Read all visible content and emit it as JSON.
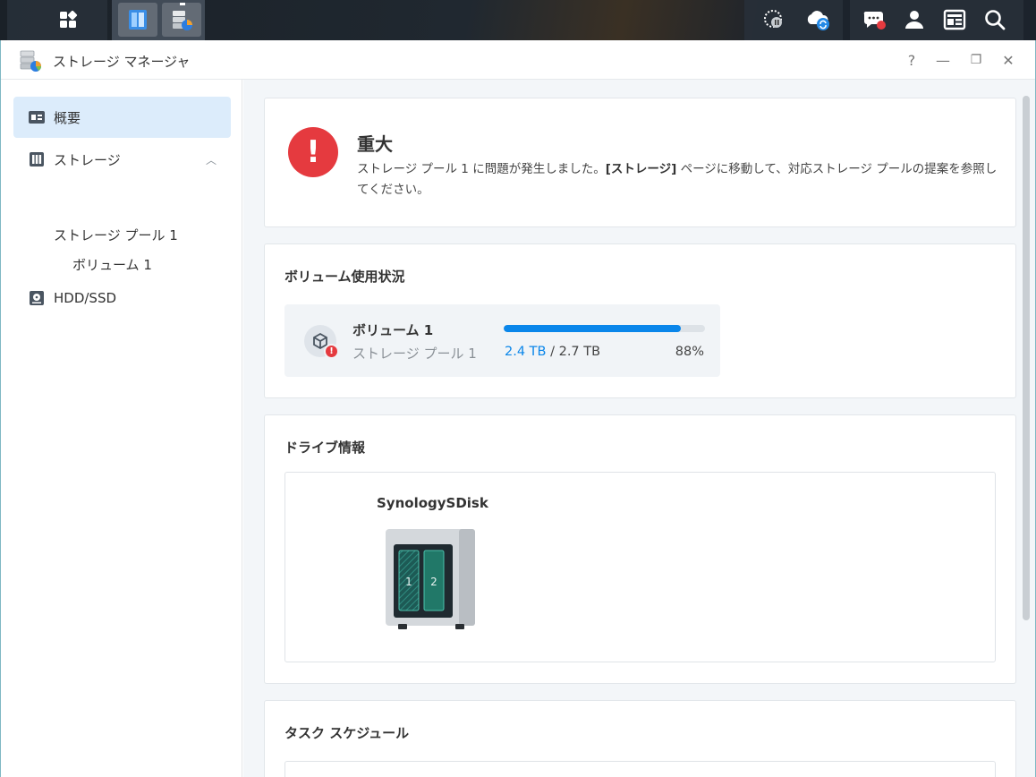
{
  "taskbar": {
    "buttons": [
      {
        "name": "main-menu-icon"
      },
      {
        "name": "file-station-icon"
      },
      {
        "name": "storage-manager-icon"
      }
    ],
    "tray": [
      {
        "name": "backup-pause-icon"
      },
      {
        "name": "cloud-sync-icon"
      },
      {
        "name": "notifications-icon"
      },
      {
        "name": "user-icon"
      },
      {
        "name": "widgets-icon"
      },
      {
        "name": "search-icon"
      }
    ]
  },
  "window": {
    "title": "ストレージ マネージャ",
    "help": "?",
    "minimize": "—",
    "restore": "❐",
    "close": "✕"
  },
  "sidebar": {
    "overview": "概要",
    "storage": "ストレージ",
    "storage_pool": "ストレージ プール 1",
    "volume": "ボリューム 1",
    "hdd": "HDD/SSD"
  },
  "alert": {
    "title": "重大",
    "msg_part1": "ストレージ プール 1 に問題が発生しました。",
    "msg_bold": "[ストレージ]",
    "msg_part2": " ページに移動して、対応ストレージ プールの提案を参照してください。",
    "color": "#e53a3f"
  },
  "volume_usage": {
    "title": "ボリューム使用状況",
    "name": "ボリューム 1",
    "pool": "ストレージ プール 1",
    "used": "2.4 TB",
    "separator": " / ",
    "total": "2.7 TB",
    "percent_label": "88%",
    "percent": 0.88,
    "bar_color": "#0a86ea"
  },
  "drive_info": {
    "title": "ドライブ情報",
    "nas_name": "SynologySDisk",
    "bays": [
      "1",
      "2"
    ]
  },
  "task_schedule": {
    "title": "タスク スケジュール"
  }
}
